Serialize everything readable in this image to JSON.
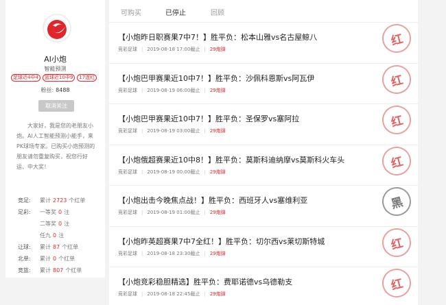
{
  "profile": {
    "name": "AI小炮",
    "role": "智能预测",
    "tags": [
      "足球近4中4",
      "篮球近10中9",
      "17连红"
    ],
    "fans_label": "粉丝:",
    "fans_count": "8488",
    "unfollow_label": "取消关注",
    "intro": "大家好，我是您的老朋友小炮。AI人工智能预测小能手，来PK球场专家。已购买小炮预测的朋友请勿重复购买，祝您行好运、中大奖！"
  },
  "stats": [
    {
      "label": "竞足:",
      "prefix": "累计",
      "num": "2723",
      "suffix": "个红单"
    },
    {
      "label": "足彩:",
      "prefix": "一等奖",
      "num": "0",
      "suffix": "注"
    },
    {
      "label": "",
      "prefix": "二等奖",
      "num": "0",
      "suffix": "注"
    },
    {
      "label": "",
      "prefix": "任九",
      "num": "0",
      "suffix": "注"
    },
    {
      "label": "让球:",
      "prefix": "累计",
      "num": "87",
      "suffix": "个红单"
    },
    {
      "label": "北单:",
      "prefix": "累计",
      "num": "0",
      "suffix": "个红单"
    },
    {
      "label": "竞篮:",
      "prefix": "累计",
      "num": "807",
      "suffix": "个红单"
    }
  ],
  "tabs": [
    "可购买",
    "已停止",
    "回顾"
  ],
  "items": [
    {
      "title": "【小炮昨日职赛果7中7！】胜平负：松本山雅vs名古屋鲸八",
      "category": "竞彩足球",
      "deadline": "2019-08-18 17:00截止",
      "price": "29炮弹",
      "result": "红"
    },
    {
      "title": "【小炮巴甲赛果近10中7！】胜平负：沙佩科恩斯vs阿瓦伊",
      "category": "竞彩足球",
      "deadline": "2019-08-19 06:00截止",
      "price": "29炮弹",
      "result": "红"
    },
    {
      "title": "【小炮巴甲赛果近10中7！】胜平负：圣保罗vs塞阿拉",
      "category": "竞彩足球",
      "deadline": "2019-08-19 03:00截止",
      "price": "29炮弹",
      "result": "红"
    },
    {
      "title": "【小炮俄超赛果近10中8！】胜平负：莫斯科迪纳摩vs莫斯科火车头",
      "category": "竞彩足球",
      "deadline": "2019-08-19 00:00截止",
      "price": "29炮弹",
      "result": "红"
    },
    {
      "title": "【小炮出击今晚焦点战！】胜平负：西班牙人vs塞维利亚",
      "category": "竞彩足球",
      "deadline": "2019-08-19 01:00截止",
      "price": "29炮弹",
      "result": "黑"
    },
    {
      "title": "【小炮昨英超赛果7中7全红！】胜平负：切尔西vs莱切斯特城",
      "category": "竞彩足球",
      "deadline": "2019-08-18 23:30截止",
      "price": "29炮弹",
      "result": "红"
    },
    {
      "title": "【小炮竞彩稳胆精选】胜平负：费耶诺德vs乌德勒支",
      "category": "竞彩足球",
      "deadline": "2019-08-18 22:45截止",
      "price": "29炮弹",
      "result": "红"
    }
  ]
}
